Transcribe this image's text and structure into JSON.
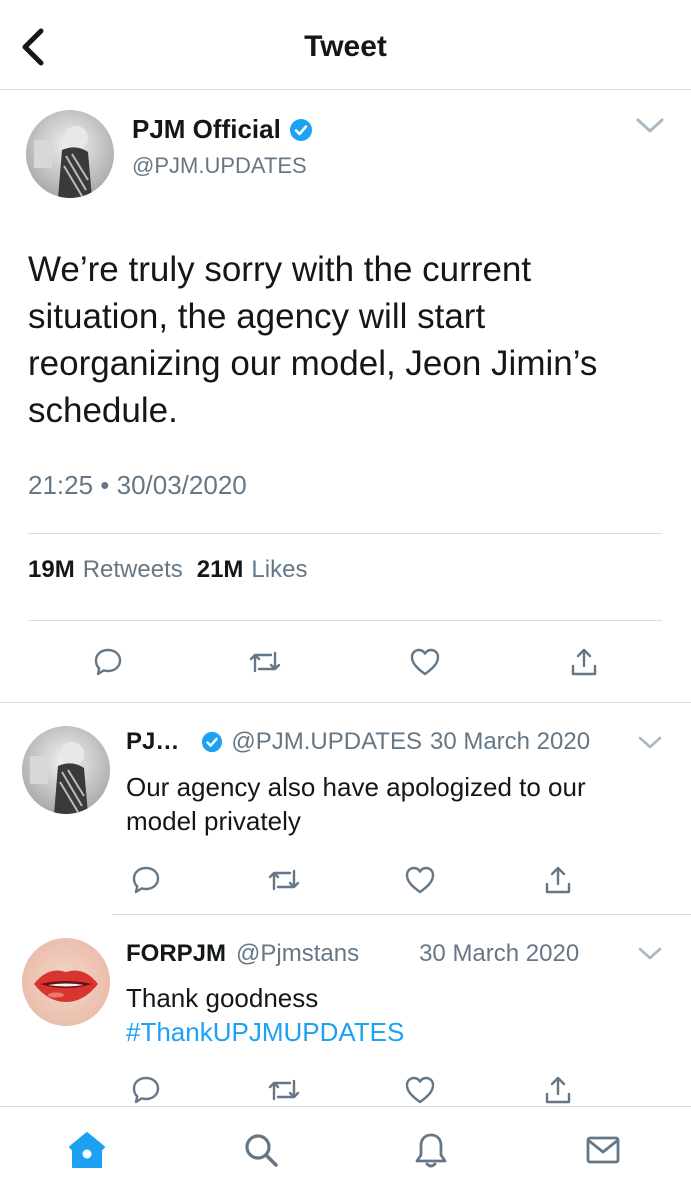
{
  "header": {
    "title": "Tweet"
  },
  "main_tweet": {
    "display_name": "PJM Official",
    "handle": "@PJM.UPDATES",
    "text": "We’re truly sorry with the current situation, the agency will start reorganizing our model, Jeon Jimin’s schedule.",
    "timestamp": "21:25 • 30/03/2020",
    "retweets_count": "19M",
    "retweets_label": "Retweets",
    "likes_count": "21M",
    "likes_label": "Likes"
  },
  "replies": [
    {
      "display_name": "PJ…",
      "handle": "@PJM.UPDATES",
      "date": "30 March 2020",
      "text": "Our agency also have apologized to our model privately"
    },
    {
      "display_name": "FORPJM",
      "handle": "@Pjmstans",
      "date": "30 March 2020",
      "text": "Thank goodness",
      "hashtag": "#ThankUPJMUPDATES"
    }
  ],
  "icons": {
    "back": "chevron-left-icon",
    "verified": "verified-badge-icon",
    "reply": "reply-icon",
    "retweet": "retweet-icon",
    "like": "heart-icon",
    "share": "share-icon",
    "home": "home-icon",
    "search": "search-icon",
    "notifications": "bell-icon",
    "messages": "mail-icon"
  },
  "colors": {
    "accent": "#1da1f2",
    "muted": "#657786",
    "text": "#14171a",
    "divider": "#d8dde1"
  }
}
